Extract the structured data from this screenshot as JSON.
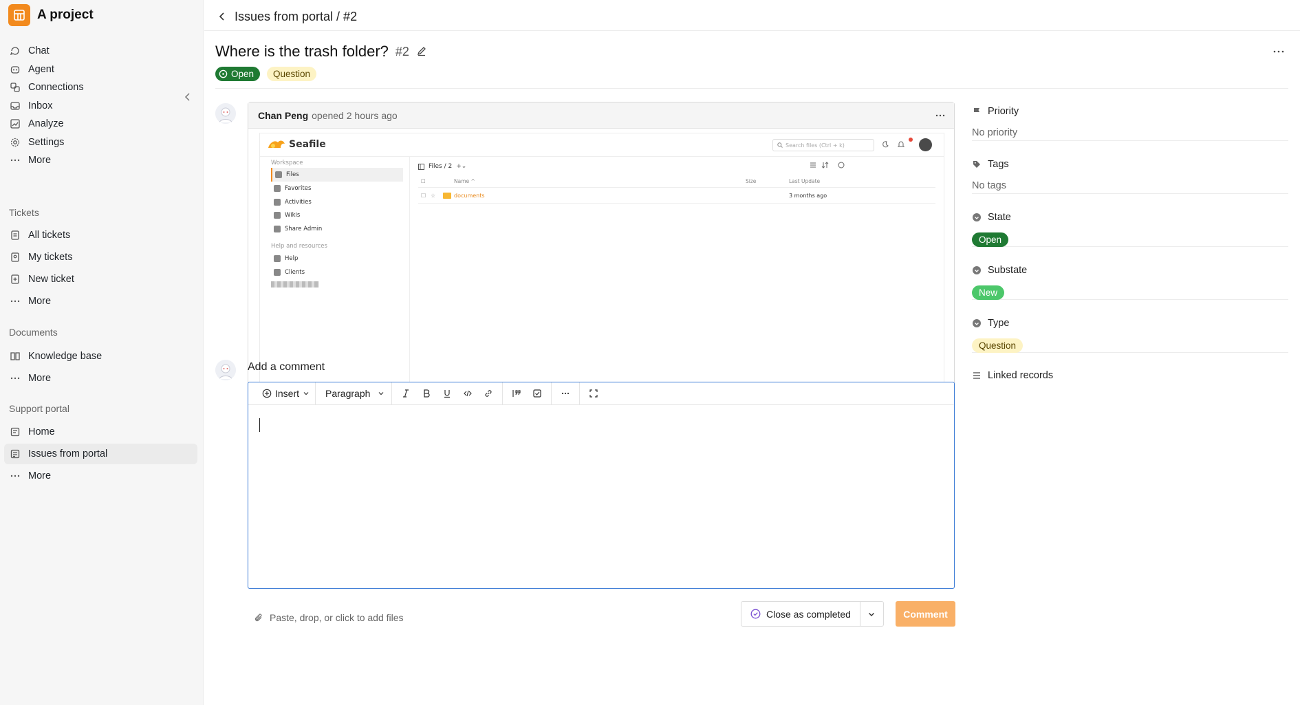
{
  "app": {
    "project_name": "A project"
  },
  "sidebar": {
    "main_items": [
      {
        "label": "Chat"
      },
      {
        "label": "Agent"
      },
      {
        "label": "Connections"
      },
      {
        "label": "Inbox"
      },
      {
        "label": "Analyze"
      },
      {
        "label": "Settings"
      },
      {
        "label": "More"
      }
    ],
    "sections": [
      {
        "label": "Tickets",
        "items": [
          {
            "label": "All tickets"
          },
          {
            "label": "My tickets"
          },
          {
            "label": "New ticket"
          },
          {
            "label": "More"
          }
        ]
      },
      {
        "label": "Documents",
        "items": [
          {
            "label": "Knowledge base"
          },
          {
            "label": "More"
          }
        ]
      },
      {
        "label": "Support portal",
        "items": [
          {
            "label": "Home"
          },
          {
            "label": "Issues from portal"
          },
          {
            "label": "More"
          }
        ]
      }
    ],
    "active_item": "Issues from portal"
  },
  "header": {
    "breadcrumb": "Issues from portal / #2"
  },
  "issue": {
    "title": "Where is the trash folder?",
    "number": "#2",
    "state_badge": "Open",
    "type_badge": "Question",
    "author": "Chan Peng",
    "opened_text": "opened 2 hours ago"
  },
  "embedded_screenshot": {
    "logo_text": "Seafile",
    "search_placeholder": "Search files (Ctrl + k)",
    "workspace_label": "Workspace",
    "nav": [
      "Files",
      "Favorites",
      "Activities",
      "Wikis",
      "Share Admin"
    ],
    "help_label": "Help and resources",
    "help_nav": [
      "Help",
      "Clients"
    ],
    "breadcrumb": "Files / 2",
    "columns": {
      "name": "Name ^",
      "size": "Size",
      "last_update": "Last Update"
    },
    "row": {
      "name": "documents",
      "last_update": "3 months ago"
    }
  },
  "comment": {
    "heading": "Add a comment",
    "toolbar": {
      "insert": "Insert",
      "paragraph": "Paragraph"
    },
    "attach_hint": "Paste, drop, or click to add files",
    "close_button": "Close as completed",
    "submit_button": "Comment"
  },
  "meta": {
    "priority_label": "Priority",
    "priority_value": "No priority",
    "tags_label": "Tags",
    "tags_value": "No tags",
    "state_label": "State",
    "state_value": "Open",
    "substate_label": "Substate",
    "substate_value": "New",
    "type_label": "Type",
    "type_value": "Question",
    "linked_label": "Linked records"
  },
  "colors": {
    "brand": "#f28a1e",
    "open_green": "#1f7a33",
    "new_green": "#4cc76a",
    "question_yellow": "#fdf3c4",
    "editor_focus": "#3c7cd6",
    "comment_button": "#f9b067"
  }
}
